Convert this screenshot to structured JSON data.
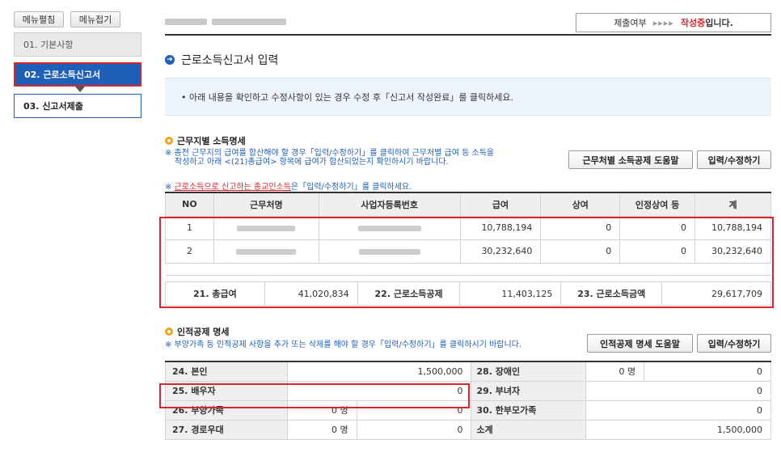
{
  "sidebar": {
    "expand_label": "메뉴펼침",
    "collapse_label": "메뉴접기",
    "items": [
      {
        "label": "01. 기본사항"
      },
      {
        "label": "02. 근로소득신고서"
      },
      {
        "label": "03. 신고서제출"
      }
    ]
  },
  "header": {
    "status_label": "제출여부",
    "status_arrows": "▸▸▸▸",
    "status_value": "작성중",
    "status_suffix": "입니다."
  },
  "page": {
    "title": "근로소득신고서 입력",
    "notice": "• 아래 내용을 확인하고 수정사항이 있는 경우 수정 후「신고서 작성완료」를 클릭하세요."
  },
  "income": {
    "title": "근무지별 소득명세",
    "note_line1": "※ 종전 근무지의 급여를 합산해야 할 경우「입력/수정하기」를 클릭하여 근무처별 급여 등 소득을",
    "note_line2": "작성하고 아래 <(21)총급여> 항목에 급여가 합산되었는지 확인하시기 바랍니다.",
    "note_red_prefix": "※ ",
    "note_red_link": "근로소득으로 신고하는 종교인소득",
    "note_red_suffix": "은「입력/수정하기」를 클릭하세요.",
    "help_button": "근무처별 소득공제 도움말",
    "edit_button": "입력/수정하기",
    "columns": [
      "NO",
      "근무처명",
      "사업자등록번호",
      "급여",
      "상여",
      "인정상여 등",
      "계"
    ],
    "rows": [
      {
        "no": "1",
        "salary": "10,788,194",
        "bonus": "0",
        "recognized": "0",
        "total": "10,788,194"
      },
      {
        "no": "2",
        "salary": "30,232,640",
        "bonus": "0",
        "recognized": "0",
        "total": "30,232,640"
      }
    ],
    "summary": {
      "total_pay_label": "21. 총급여",
      "total_pay": "41,020,834",
      "deduction_label": "22. 근로소득공제",
      "deduction": "11,403,125",
      "income_label": "23. 근로소득금액",
      "income": "29,617,709"
    }
  },
  "personal": {
    "title": "인적공제 명세",
    "note": "※ 부양가족 등 인적공제 사항을 추가 또는 삭제를 해야 할 경우「입력/수정하기」를 클릭하시기 바랍니다.",
    "help_button": "인적공제 명세 도움말",
    "edit_button": "입력/수정하기",
    "rows": [
      {
        "l_label": "24. 본인",
        "l_count": "",
        "l_value": "1,500,000",
        "r_label": "28. 장애인",
        "r_count": "0 명",
        "r_value": "0"
      },
      {
        "l_label": "25. 배우자",
        "l_count": "",
        "l_value": "0",
        "r_label": "29. 부녀자",
        "r_count": "",
        "r_value": "0"
      },
      {
        "l_label": "26. 부양가족",
        "l_count": "0 명",
        "l_value": "0",
        "r_label": "30. 한부모가족",
        "r_count": "",
        "r_value": "0"
      },
      {
        "l_label": "27. 경로우대",
        "l_count": "0 명",
        "l_value": "0",
        "r_label": "소계",
        "r_count": "",
        "r_value": "1,500,000"
      }
    ]
  },
  "colors": {
    "accent_blue": "#1e5fb7",
    "highlight_red": "#d9262c",
    "bullet_orange": "#f0a21b"
  }
}
